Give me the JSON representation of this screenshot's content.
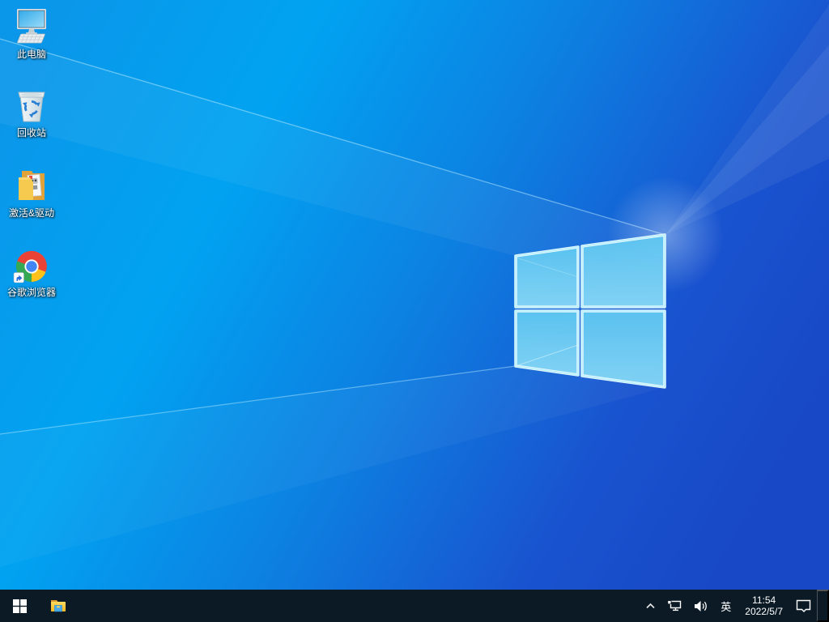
{
  "desktop": {
    "icons": [
      {
        "id": "this-pc",
        "label": "此电脑"
      },
      {
        "id": "recycle-bin",
        "label": "回收站"
      },
      {
        "id": "activation-drivers",
        "label": "激活&驱动"
      },
      {
        "id": "google-chrome",
        "label": "谷歌浏览器"
      }
    ]
  },
  "taskbar": {
    "tray": {
      "language": "英",
      "time": "11:54",
      "date": "2022/5/7"
    }
  },
  "colors": {
    "wallpaper_left": "#01a3f1",
    "wallpaper_right": "#1848c5",
    "logo_pane_fill": "#63c9f2",
    "logo_edge": "#c6f4ff",
    "taskbar_bg": "#0c1a26",
    "icon_text": "#ffffff"
  }
}
